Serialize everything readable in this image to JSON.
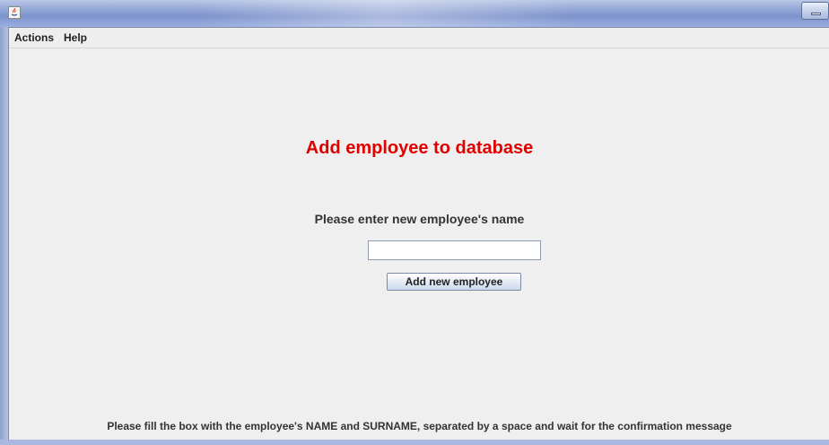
{
  "window": {
    "title": ""
  },
  "menu": {
    "actions": "Actions",
    "help": "Help"
  },
  "form": {
    "heading": "Add employee to database",
    "prompt": "Please enter new employee's name",
    "name_value": "",
    "add_button": "Add new employee",
    "hint": "Please fill the box with the employee's NAME and SURNAME, separated by a space and wait for the confirmation message"
  },
  "colors": {
    "heading": "#e00000",
    "background": "#efefef"
  },
  "icons": {
    "app": "java-icon",
    "minimize": "minimize-icon"
  }
}
